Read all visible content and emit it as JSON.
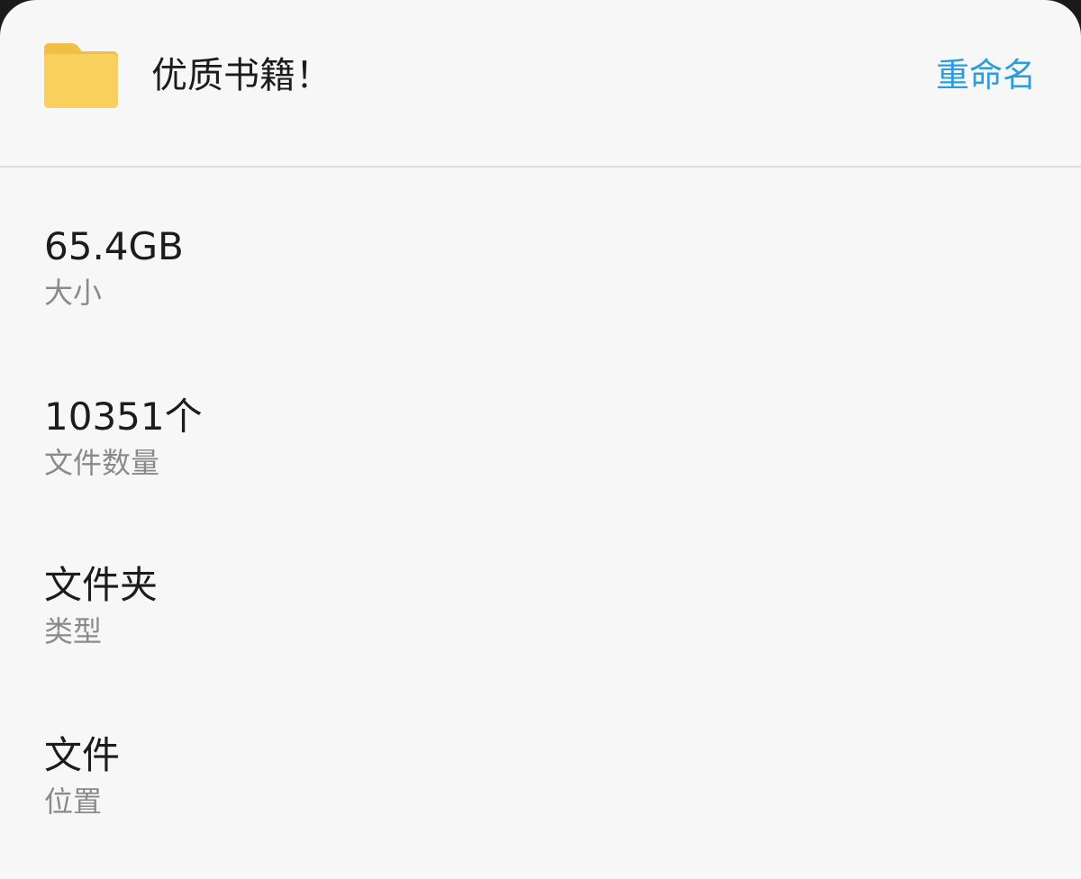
{
  "header": {
    "folder_icon": "folder-icon",
    "folder_name": "优质书籍！",
    "rename_label": "重命名",
    "accent_color": "#2a9de0"
  },
  "details": [
    {
      "value": "65.4GB",
      "label": "大小"
    },
    {
      "value": "10351个",
      "label": "文件数量"
    },
    {
      "value": "文件夹",
      "label": "类型"
    },
    {
      "value": "文件",
      "label": "位置"
    }
  ]
}
